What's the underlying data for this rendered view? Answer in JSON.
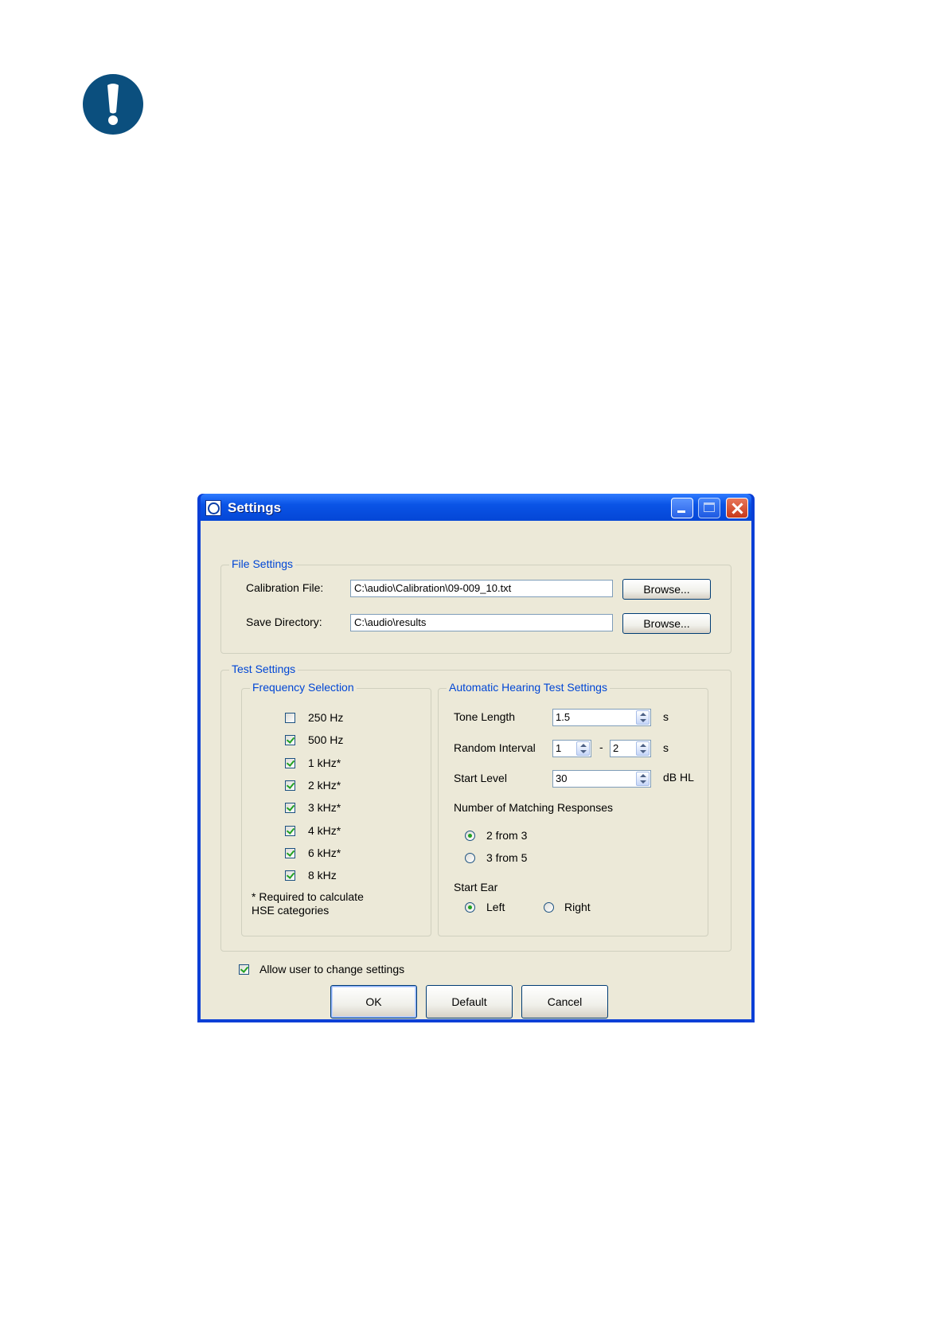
{
  "window": {
    "title": "Settings"
  },
  "file_settings": {
    "title": "File Settings",
    "calibration_label": "Calibration File:",
    "calibration_value": "C:\\audio\\Calibration\\09-009_10.txt",
    "save_label": "Save Directory:",
    "save_value": "C:\\audio\\results",
    "browse_label": "Browse..."
  },
  "test_settings": {
    "title": "Test Settings",
    "frequency": {
      "title": "Frequency Selection",
      "items": [
        {
          "label": "250 Hz",
          "checked": false
        },
        {
          "label": "500 Hz",
          "checked": true
        },
        {
          "label": "1 kHz*",
          "checked": true
        },
        {
          "label": "2 kHz*",
          "checked": true
        },
        {
          "label": "3 kHz*",
          "checked": true
        },
        {
          "label": "4 kHz*",
          "checked": true
        },
        {
          "label": "6 kHz*",
          "checked": true
        },
        {
          "label": "8 kHz",
          "checked": true
        }
      ],
      "note_line1": "* Required to calculate",
      "note_line2": "HSE categories"
    },
    "auto": {
      "title": "Automatic Hearing Test Settings",
      "tone_length_label": "Tone Length",
      "tone_length_value": "1.5",
      "tone_length_unit": "s",
      "random_interval_label": "Random Interval",
      "random_min": "1",
      "random_sep": "-",
      "random_max": "2",
      "random_unit": "s",
      "start_level_label": "Start Level",
      "start_level_value": "30",
      "start_level_unit": "dB HL",
      "matching_label": "Number of Matching Responses",
      "matching_options": [
        {
          "label": "2 from 3",
          "selected": true
        },
        {
          "label": "3 from 5",
          "selected": false
        }
      ],
      "start_ear_label": "Start Ear",
      "ear_options": [
        {
          "label": "Left",
          "selected": true
        },
        {
          "label": "Right",
          "selected": false
        }
      ]
    }
  },
  "allow_change": {
    "label": "Allow user to change settings",
    "checked": true
  },
  "buttons": {
    "ok": "OK",
    "default": "Default",
    "cancel": "Cancel"
  },
  "colors": {
    "titlebar": "#0a54e6",
    "group_title": "#0046d5",
    "dialog_bg": "#ece9d8",
    "check_mark": "#21a121"
  }
}
